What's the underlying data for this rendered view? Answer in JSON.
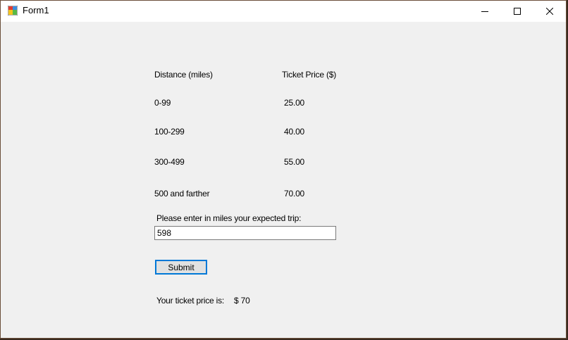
{
  "window": {
    "title": "Form1"
  },
  "table": {
    "headers": {
      "distance": "Distance (miles)",
      "price": "Ticket Price ($)"
    },
    "rows": [
      {
        "distance": "0-99",
        "price": "25.00"
      },
      {
        "distance": "100-299",
        "price": "40.00"
      },
      {
        "distance": "300-499",
        "price": "55.00"
      },
      {
        "distance": "500 and farther",
        "price": "70.00"
      }
    ]
  },
  "form": {
    "prompt": "Please enter in miles your expected trip:",
    "miles_value": "598",
    "submit_label": "Submit",
    "result_label": "Your ticket price is:",
    "result_value": "$ 70"
  },
  "colors": {
    "accent": "#0078d7",
    "background": "#f0f0f0"
  }
}
